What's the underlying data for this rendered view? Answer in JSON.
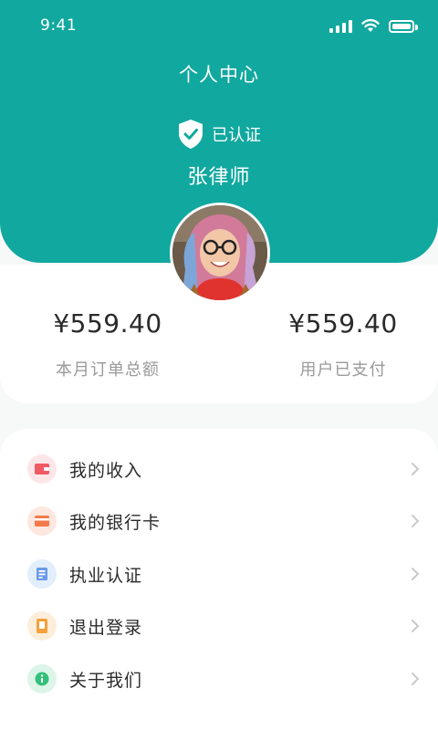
{
  "status_bar": {
    "time": "9:41",
    "battery_level": 1.0,
    "signal_bars": 4
  },
  "header": {
    "title": "个人中心",
    "verified_label": "已认证",
    "name": "张律师",
    "colors": {
      "primary": "#11a89f"
    }
  },
  "stats": [
    {
      "value": "¥559.40",
      "label": "本月订单总额"
    },
    {
      "value": "¥559.40",
      "label": "用户已支付"
    }
  ],
  "menu": [
    {
      "label": "我的收入",
      "icon": "wallet-icon",
      "bg": "#fde6e8",
      "color": "#f05a64"
    },
    {
      "label": "我的银行卡",
      "icon": "bank-card-icon",
      "bg": "#fde7df",
      "color": "#f47a4a"
    },
    {
      "label": "执业认证",
      "icon": "certificate-icon",
      "bg": "#e2eefc",
      "color": "#6a9ae8"
    },
    {
      "label": "退出登录",
      "icon": "logout-icon",
      "bg": "#fdeedb",
      "color": "#f2a13c"
    },
    {
      "label": "关于我们",
      "icon": "info-icon",
      "bg": "#ddf5e8",
      "color": "#33c07a"
    }
  ]
}
